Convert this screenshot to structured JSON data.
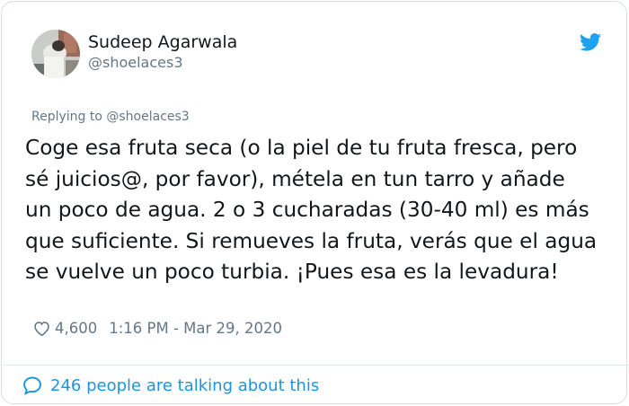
{
  "author": {
    "display_name": "Sudeep Agarwala",
    "handle": "@shoelaces3"
  },
  "reply": {
    "replying_to": "Replying to @shoelaces3"
  },
  "tweet": {
    "text": "Coge esa fruta seca (o la piel de tu fruta fresca, pero\nsé juicios@, por favor), métela en tun tarro y añade\nun poco de agua. 2 o 3 cucharadas (30-40 ml) es más\nque suficiente. Si remueves la fruta, verás que el agua\nse vuelve un poco turbia. ¡Pues esa es la levadura!",
    "likes": "4,600",
    "timestamp": "1:16 PM - Mar 29, 2020"
  },
  "footer": {
    "talking": "246 people are talking about this"
  },
  "icons": {
    "brand": "twitter-bird-icon",
    "like": "heart-icon",
    "comment": "speech-bubble-icon"
  },
  "colors": {
    "twitter_blue": "#1da1f2",
    "link_blue": "#1b95e0",
    "muted_gray": "#657786"
  }
}
